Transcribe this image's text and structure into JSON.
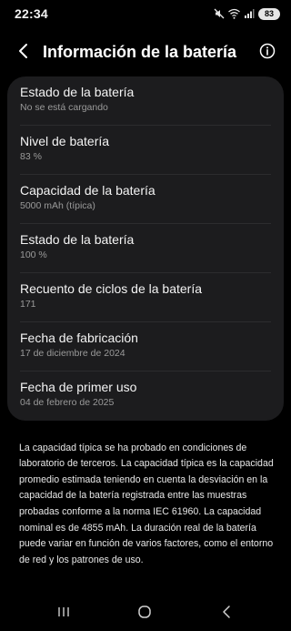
{
  "status_bar": {
    "time": "22:34",
    "battery_level": "83",
    "icons": [
      "mute-icon",
      "wifi-icon",
      "signal-icon",
      "battery-icon"
    ]
  },
  "header": {
    "title": "Información de la batería",
    "back_icon": "chevron-left-icon",
    "info_icon": "info-icon"
  },
  "items": [
    {
      "title": "Estado de la batería",
      "value": "No se está cargando"
    },
    {
      "title": "Nivel de batería",
      "value": "83 %"
    },
    {
      "title": "Capacidad de la batería",
      "value": "5000 mAh (típica)"
    },
    {
      "title": "Estado de la batería",
      "value": "100 %"
    },
    {
      "title": "Recuento de ciclos de la batería",
      "value": "171"
    },
    {
      "title": "Fecha de fabricación",
      "value": "17 de diciembre de 2024"
    },
    {
      "title": "Fecha de primer uso",
      "value": "04 de febrero de 2025"
    }
  ],
  "description": "La capacidad típica se ha probado en condiciones de laboratorio de terceros. La capacidad típica es la capacidad promedio estimada teniendo en cuenta la desviación en la capacidad de la batería registrada entre las muestras probadas conforme a la norma IEC 61960. La capacidad nominal es de 4855 mAh. La duración real de la batería puede variar en función de varios factores, como el entorno de red y los patrones de uso.",
  "nav_bar": {
    "recents_icon": "recents-icon",
    "home_icon": "home-icon",
    "back_icon": "back-icon"
  },
  "colors": {
    "background": "#000000",
    "card": "#1c1c1e",
    "divider": "#2c2c2e",
    "secondary_text": "#9a9a9a"
  }
}
